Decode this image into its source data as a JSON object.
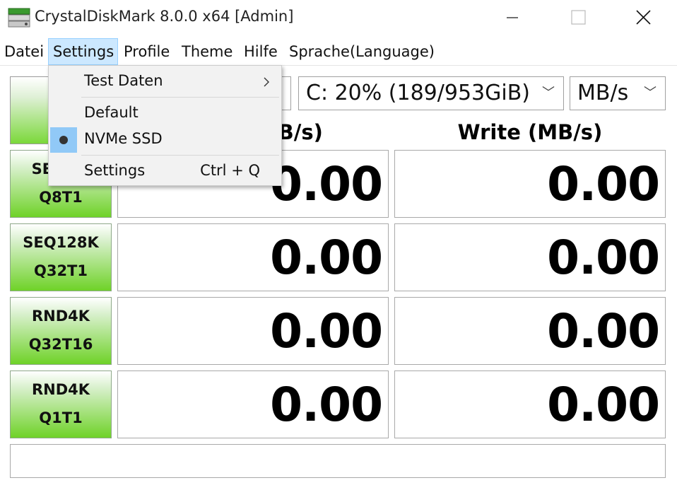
{
  "window": {
    "title": "CrystalDiskMark 8.0.0 x64 [Admin]",
    "controls": [
      "minimize",
      "maximize",
      "close"
    ]
  },
  "menubar": {
    "items": [
      {
        "label": "Datei"
      },
      {
        "label": "Settings",
        "active": true
      },
      {
        "label": "Profile"
      },
      {
        "label": "Theme"
      },
      {
        "label": "Hilfe"
      },
      {
        "label": "Sprache(Language)"
      }
    ]
  },
  "settings_menu": {
    "items": [
      {
        "label": "Test Daten",
        "submenu": true
      },
      {
        "label": "Default"
      },
      {
        "label": "NVMe SSD",
        "checked": true
      },
      {
        "label": "Settings",
        "shortcut": "Ctrl + Q"
      }
    ]
  },
  "controls": {
    "drive": "C: 20% (189/953GiB)",
    "unit": "MB/s"
  },
  "headers": {
    "read": "Read (MB/s)",
    "write": "Write (MB/s)"
  },
  "tests": [
    {
      "line1": "SEQ1M",
      "line2": "Q8T1",
      "read": "0.00",
      "write": "0.00"
    },
    {
      "line1": "SEQ128K",
      "line2": "Q32T1",
      "read": "0.00",
      "write": "0.00"
    },
    {
      "line1": "RND4K",
      "line2": "Q32T16",
      "read": "0.00",
      "write": "0.00"
    },
    {
      "line1": "RND4K",
      "line2": "Q1T1",
      "read": "0.00",
      "write": "0.00"
    }
  ],
  "colors": {
    "accent_green": "#6fd228",
    "menu_highlight": "#cce8ff",
    "check_highlight": "#91c9f7"
  }
}
